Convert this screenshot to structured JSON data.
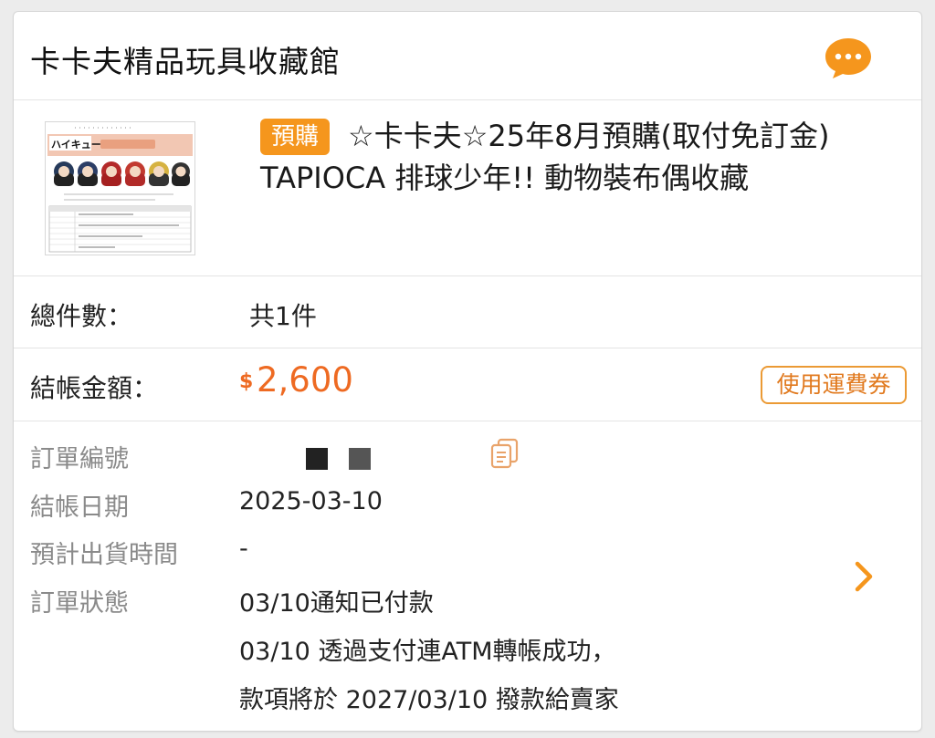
{
  "shop": {
    "name": "卡卡夫精品玩具收藏館",
    "chat_icon": "chat-bubble-icon"
  },
  "product": {
    "tag": "預購",
    "title": "☆卡卡夫☆25年8月預購(取付免訂金) TAPIOCA 排球少年!! 動物裝布偶收藏",
    "thumbnail_logo": "ハイキュー!!"
  },
  "summary": {
    "count_label": "總件數：",
    "count_value": "共1件",
    "amount_label": "結帳金額：",
    "currency_symbol": "$",
    "amount_value": "2,600",
    "coupon_label": "使用運費券"
  },
  "details": {
    "order_no_label": "訂單編號",
    "checkout_date_label": "結帳日期",
    "checkout_date": "2025-03-10",
    "ship_time_label": "預計出貨時間",
    "ship_time": "-",
    "status_label": "訂單狀態",
    "status_lines": [
      "03/10通知已付款",
      "03/10 透過支付連ATM轉帳成功，",
      "款項將於 2027/03/10 撥款給賣家"
    ]
  },
  "colors": {
    "accent": "#f5961d",
    "price": "#ee6a22"
  }
}
